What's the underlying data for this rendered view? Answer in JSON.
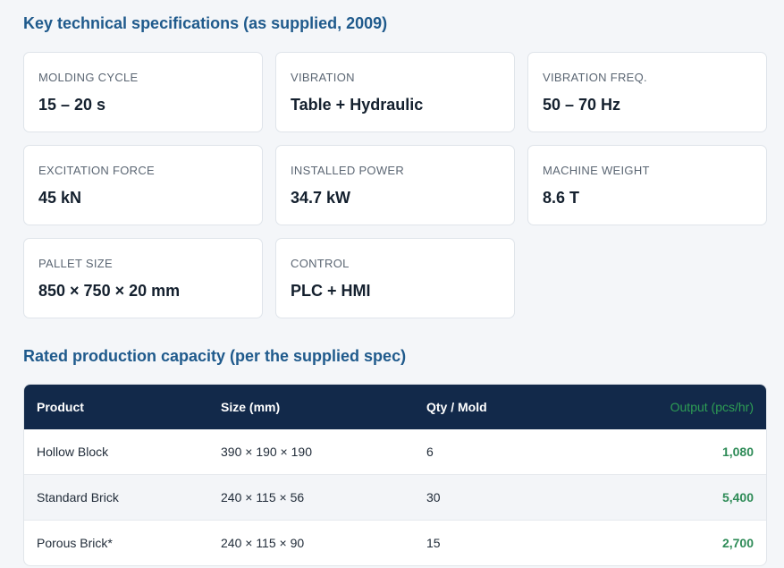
{
  "specs_heading": "Key technical specifications (as supplied, 2009)",
  "specs": [
    {
      "label": "MOLDING CYCLE",
      "value": "15 – 20 s"
    },
    {
      "label": "VIBRATION",
      "value": "Table + Hydraulic"
    },
    {
      "label": "VIBRATION FREQ.",
      "value": "50 – 70 Hz"
    },
    {
      "label": "EXCITATION FORCE",
      "value": "45 kN"
    },
    {
      "label": "INSTALLED POWER",
      "value": "34.7 kW"
    },
    {
      "label": "MACHINE WEIGHT",
      "value": "8.6 T"
    },
    {
      "label": "PALLET SIZE",
      "value": "850 × 750 × 20 mm"
    },
    {
      "label": "CONTROL",
      "value": "PLC + HMI"
    }
  ],
  "capacity_heading": "Rated production capacity (per the supplied spec)",
  "table": {
    "headers": [
      "Product",
      "Size (mm)",
      "Qty / Mold",
      "Output (pcs/hr)"
    ],
    "rows": [
      [
        "Hollow Block",
        "390 × 190 × 190",
        "6",
        "1,080"
      ],
      [
        "Standard Brick",
        "240 × 115 × 56",
        "30",
        "5,400"
      ],
      [
        "Porous Brick*",
        "240 × 115 × 90",
        "15",
        "2,700"
      ]
    ]
  }
}
